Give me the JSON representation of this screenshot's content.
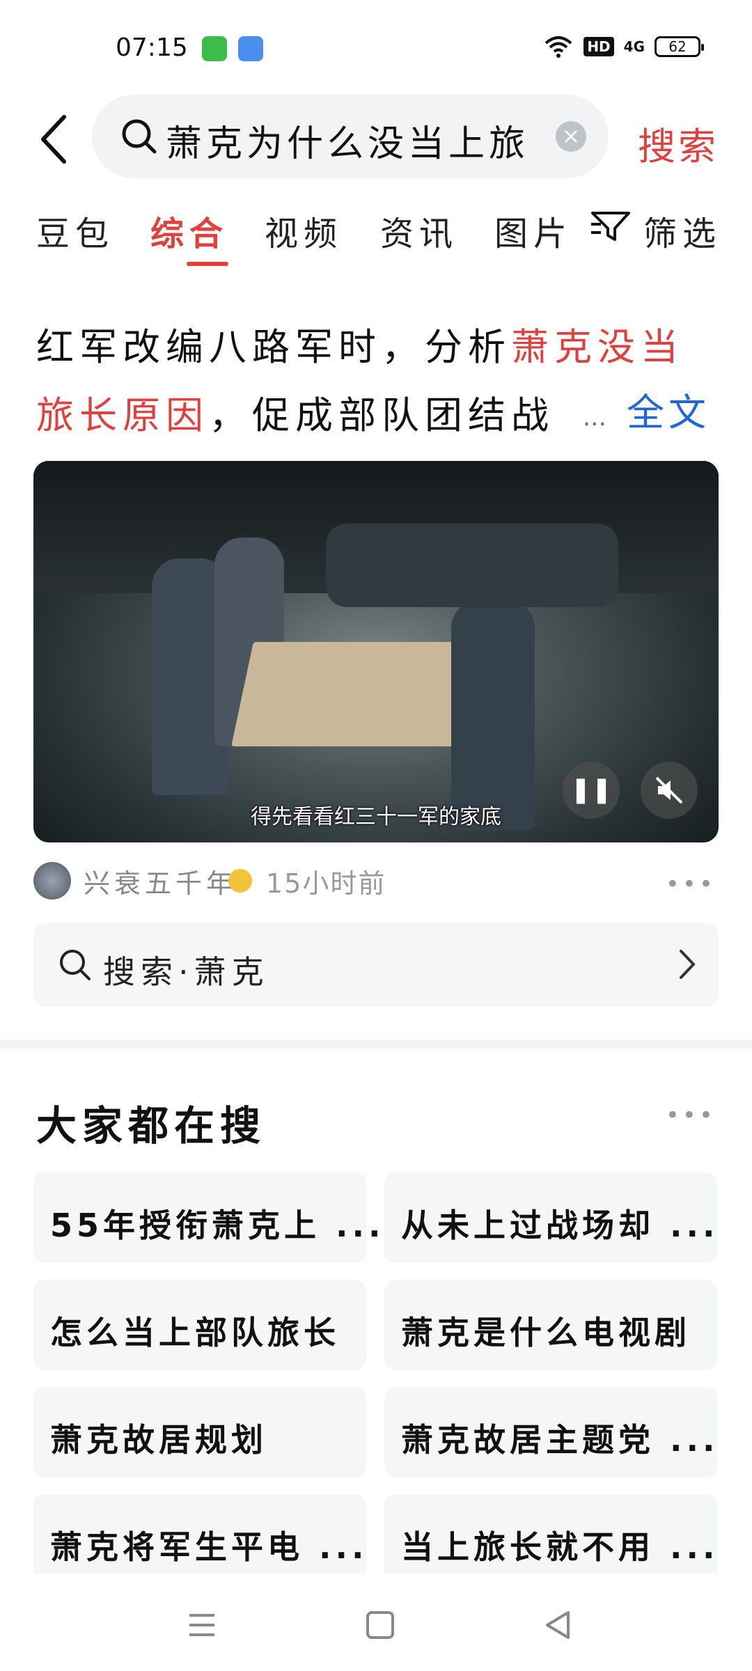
{
  "status": {
    "time": "07:15",
    "network_badge": "HD",
    "signal_label": "4G",
    "battery": "62"
  },
  "search": {
    "query": "萧克为什么没当上旅",
    "button_label": "搜索"
  },
  "tabs": [
    {
      "label": "豆包"
    },
    {
      "label": "综合"
    },
    {
      "label": "视频"
    },
    {
      "label": "资讯"
    },
    {
      "label": "图片"
    },
    {
      "label": "筛选"
    }
  ],
  "result": {
    "title_part1": "红军改编八路军时，分析",
    "title_highlight1": "萧克没当",
    "title_highlight2": "旅长原因",
    "title_part2": "，促成部队团结战",
    "more_dots": "…",
    "more_link": "全文",
    "video_caption": "得先看看红三十一军的家底",
    "author": "兴衰五千年",
    "posted": "15小时前"
  },
  "related_search": {
    "label": "搜索·萧克"
  },
  "everyone_searching": {
    "title": "大家都在搜",
    "items": [
      "55年授衔萧克上 ...",
      "从未上过战场却 ...",
      "怎么当上部队旅长",
      "萧克是什么电视剧",
      "萧克故居规划",
      "萧克故居主题党 ...",
      "萧克将军生平电 ...",
      "当上旅长就不用 ..."
    ]
  },
  "colors": {
    "accent": "#e0413c",
    "link": "#1e67d6",
    "chip_bg": "#f5f6f8"
  }
}
